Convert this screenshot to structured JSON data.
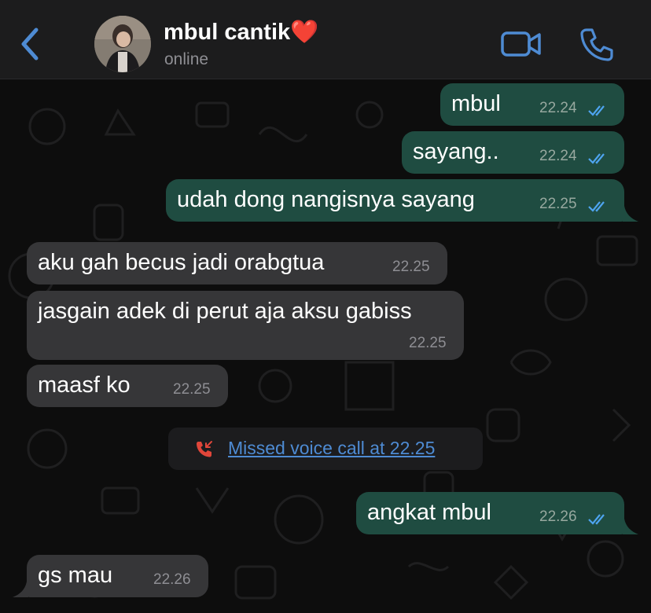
{
  "header": {
    "contact_name": "mbul cantik❤️",
    "status": "online",
    "back_icon": "chevron-left-icon",
    "video_icon": "video-camera-icon",
    "call_icon": "phone-icon"
  },
  "messages": [
    {
      "direction": "outgoing",
      "text": "mbul",
      "time": "22.24",
      "read": true
    },
    {
      "direction": "outgoing",
      "text": "sayang..",
      "time": "22.24",
      "read": true
    },
    {
      "direction": "outgoing",
      "text": "udah dong nangisnya sayang",
      "time": "22.25",
      "read": true
    },
    {
      "direction": "incoming",
      "text": "aku gah becus jadi orabgtua",
      "time": "22.25"
    },
    {
      "direction": "incoming",
      "text": "jasgain adek di perut aja aksu gabiss",
      "time": "22.25"
    },
    {
      "direction": "incoming",
      "text": "maasf ko",
      "time": "22.25"
    },
    {
      "direction": "system",
      "text": "Missed voice call at 22.25",
      "icon": "missed-call-icon"
    },
    {
      "direction": "outgoing",
      "text": "angkat mbul",
      "time": "22.26",
      "read": true
    },
    {
      "direction": "incoming",
      "text": "gs mau",
      "time": "22.26"
    }
  ],
  "colors": {
    "header_bg": "#1c1c1d",
    "chat_bg": "#0d0d0d",
    "outgoing_bubble": "#1f4c41",
    "incoming_bubble": "#363638",
    "accent_blue": "#4e8bd3",
    "missed_call_red": "#e0463a"
  }
}
